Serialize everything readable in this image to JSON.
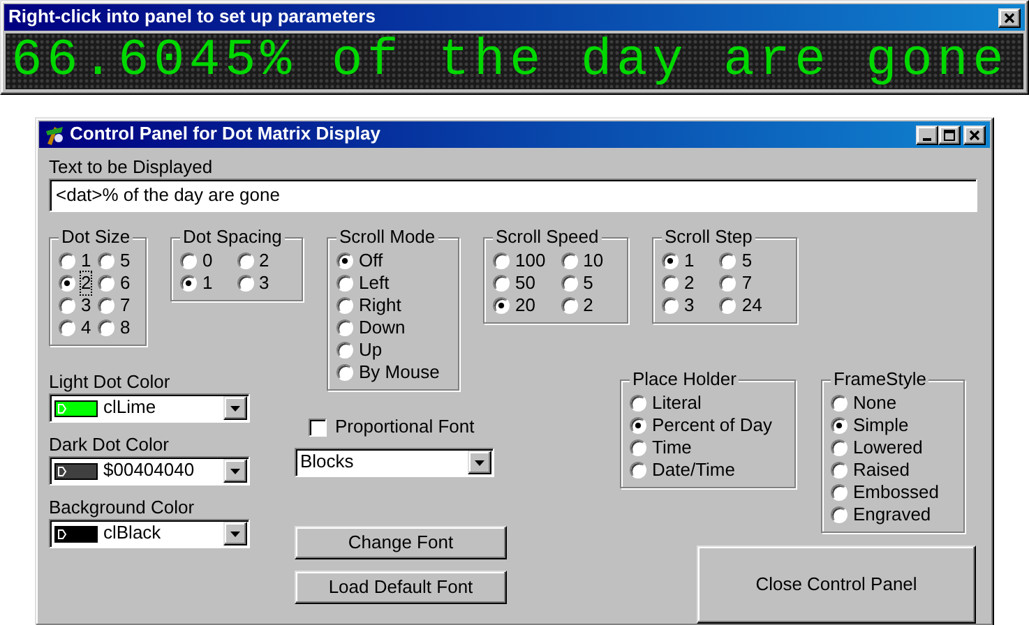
{
  "display_window": {
    "title": "Right-click into panel to set up parameters",
    "text": "66.6045% of the day are gone"
  },
  "dialog": {
    "title": "Control Panel for Dot Matrix Display",
    "text_field": {
      "label": "Text to be Displayed",
      "value": "<dat>% of the day are gone"
    },
    "radio_groups": [
      {
        "title": "Dot Size",
        "columns": [
          [
            {
              "label": "1",
              "selected": false,
              "focused": false
            },
            {
              "label": "2",
              "selected": true,
              "focused": true
            },
            {
              "label": "3",
              "selected": false,
              "focused": false
            },
            {
              "label": "4",
              "selected": false,
              "focused": false
            }
          ],
          [
            {
              "label": "5",
              "selected": false,
              "focused": false
            },
            {
              "label": "6",
              "selected": false,
              "focused": false
            },
            {
              "label": "7",
              "selected": false,
              "focused": false
            },
            {
              "label": "8",
              "selected": false,
              "focused": false
            }
          ]
        ]
      },
      {
        "title": "Dot Spacing",
        "columns": [
          [
            {
              "label": "0",
              "selected": false
            },
            {
              "label": "1",
              "selected": true
            }
          ],
          [
            {
              "label": "2",
              "selected": false
            },
            {
              "label": "3",
              "selected": false
            }
          ]
        ]
      },
      {
        "title": "Scroll Mode",
        "columns": [
          [
            {
              "label": "Off",
              "selected": true
            },
            {
              "label": "Left",
              "selected": false
            },
            {
              "label": "Right",
              "selected": false
            },
            {
              "label": "Down",
              "selected": false
            },
            {
              "label": "Up",
              "selected": false
            },
            {
              "label": "By Mouse",
              "selected": false
            }
          ]
        ]
      },
      {
        "title": "Scroll Speed",
        "columns": [
          [
            {
              "label": "100",
              "selected": false
            },
            {
              "label": "50",
              "selected": false
            },
            {
              "label": "20",
              "selected": true
            }
          ],
          [
            {
              "label": "10",
              "selected": false
            },
            {
              "label": "5",
              "selected": false
            },
            {
              "label": "2",
              "selected": false
            }
          ]
        ]
      },
      {
        "title": "Scroll Step",
        "columns": [
          [
            {
              "label": "1",
              "selected": true
            },
            {
              "label": "2",
              "selected": false
            },
            {
              "label": "3",
              "selected": false
            }
          ],
          [
            {
              "label": "5",
              "selected": false
            },
            {
              "label": "7",
              "selected": false
            },
            {
              "label": "24",
              "selected": false
            }
          ]
        ]
      }
    ],
    "color_pickers": [
      {
        "label": "Light Dot Color",
        "value": "clLime",
        "color": "#00ff00"
      },
      {
        "label": "Dark Dot Color",
        "value": "$00404040",
        "color": "#404040"
      },
      {
        "label": "Background Color",
        "value": "clBlack",
        "color": "#000000"
      }
    ],
    "proportional_font": {
      "label": "Proportional Font",
      "checked": false
    },
    "font_dropdown": {
      "value": "Blocks"
    },
    "buttons": [
      {
        "label": "Change Font"
      },
      {
        "label": "Load Default Font"
      }
    ],
    "lower_radio_groups": [
      {
        "title": "Place Holder",
        "columns": [
          [
            {
              "label": "Literal",
              "selected": false
            },
            {
              "label": "Percent of Day",
              "selected": true
            },
            {
              "label": "Time",
              "selected": false
            },
            {
              "label": "Date/Time",
              "selected": false
            }
          ]
        ]
      },
      {
        "title": "FrameStyle",
        "columns": [
          [
            {
              "label": "None",
              "selected": false
            },
            {
              "label": "Simple",
              "selected": true
            },
            {
              "label": "Lowered",
              "selected": false
            },
            {
              "label": "Raised",
              "selected": false
            },
            {
              "label": "Embossed",
              "selected": false
            },
            {
              "label": "Engraved",
              "selected": false
            }
          ]
        ]
      }
    ],
    "close_button": {
      "label": "Close Control Panel"
    }
  }
}
